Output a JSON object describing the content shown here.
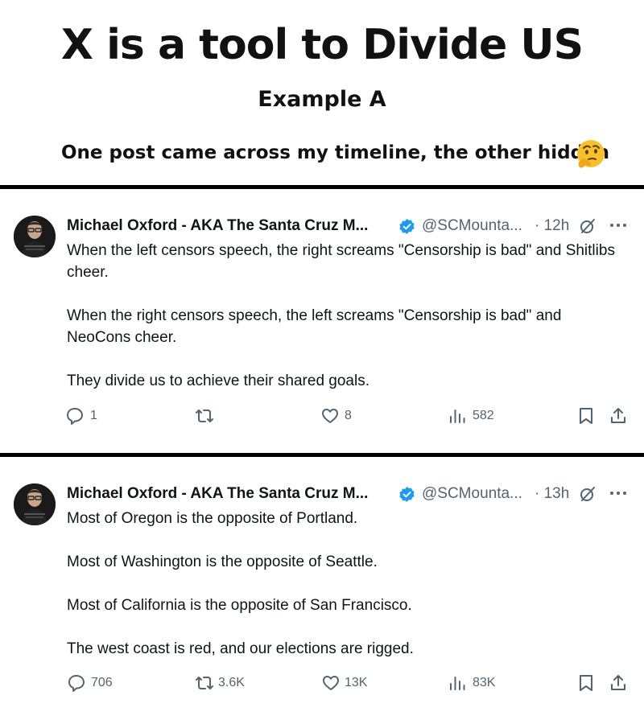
{
  "header": {
    "title": "X  is a  tool  to Divide US",
    "subtitle": "Example A",
    "caption": "One post came across my timeline, the other hidden",
    "emoji": "thinking-face-icon"
  },
  "posts": [
    {
      "author": "Michael Oxford - AKA The Santa Cruz M...",
      "handle": "@SCMounta...",
      "time": "· 12h",
      "verified": true,
      "paragraphs": [
        "When the left censors speech, the right screams \"Censorship is bad\" and Shitlibs cheer.",
        "When the right censors speech, the left screams \"Censorship is bad\" and NeoCons cheer.",
        "They divide us to achieve their shared goals."
      ],
      "replies": "1",
      "reposts": "",
      "likes": "8",
      "views": "582"
    },
    {
      "author": "Michael Oxford - AKA The Santa Cruz M...",
      "handle": "@SCMounta...",
      "time": "· 13h",
      "verified": true,
      "paragraphs": [
        "Most of Oregon is the opposite of Portland.",
        "Most of Washington is the opposite of Seattle.",
        "Most of California is the opposite of San Francisco.",
        "The west coast is red, and our elections are rigged."
      ],
      "replies": "706",
      "reposts": "3.6K",
      "likes": "13K",
      "views": "83K"
    }
  ],
  "colors": {
    "text": "#0f1419",
    "secondary": "#536471",
    "verified": "#1d9bf0",
    "divider": "#000000"
  }
}
